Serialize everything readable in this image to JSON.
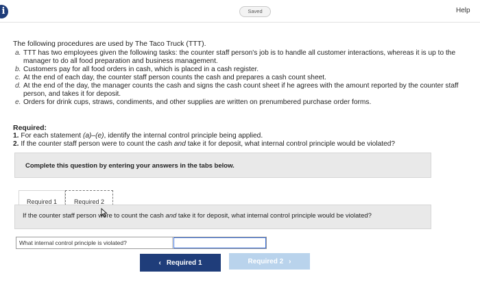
{
  "header": {
    "info_icon": "i",
    "saved_label": "Saved",
    "help_label": "Help"
  },
  "problem": {
    "intro": "The following procedures are used by The Taco Truck (TTT).",
    "statements": [
      {
        "letter": "a.",
        "text": "TTT has two employees given the following tasks: the counter staff person's job is to handle all customer interactions, whereas it is up to the manager to do all food preparation and business management."
      },
      {
        "letter": "b.",
        "text": "Customers pay for all food orders in cash, which is placed in a cash register."
      },
      {
        "letter": "c.",
        "text": "At the end of each day, the counter staff person counts the cash and prepares a cash count sheet."
      },
      {
        "letter": "d.",
        "text": "At the end of the day, the manager counts the cash and signs the cash count sheet if he agrees with the amount reported by the counter staff person, and takes it for deposit."
      },
      {
        "letter": "e.",
        "text": "Orders for drink cups, straws, condiments, and other supplies are written on prenumbered purchase order forms."
      }
    ]
  },
  "required": {
    "heading": "Required:",
    "items": [
      {
        "num": "1.",
        "text_before": "For each statement ",
        "italic1": "(a)",
        "mid": "–",
        "italic2": "(e)",
        "text_after": ", identify the internal control principle being applied."
      },
      {
        "num": "2.",
        "text_before": "If the counter staff person were to count the cash ",
        "italic": "and",
        "text_after": " take it for deposit, what internal control principle would be violated?"
      }
    ]
  },
  "instruction": "Complete this question by entering your answers in the tabs below.",
  "tabs": [
    {
      "label": "Required 1"
    },
    {
      "label": "Required 2"
    }
  ],
  "question": {
    "before": "If the counter staff person were to count the cash ",
    "italic": "and",
    "after": " take it for deposit, what internal control principle would be violated?"
  },
  "answer": {
    "label": "What internal control principle is violated?",
    "value": "",
    "placeholder": ""
  },
  "nav": {
    "prev_label": "Required 1",
    "next_label": "Required 2",
    "prev_chevron": "‹",
    "next_chevron": "›"
  },
  "colors": {
    "accent": "#1f3d7a",
    "disabled_button": "#b9d3ec",
    "panel": "#e9e9e9",
    "focus": "#3a6fd8"
  }
}
